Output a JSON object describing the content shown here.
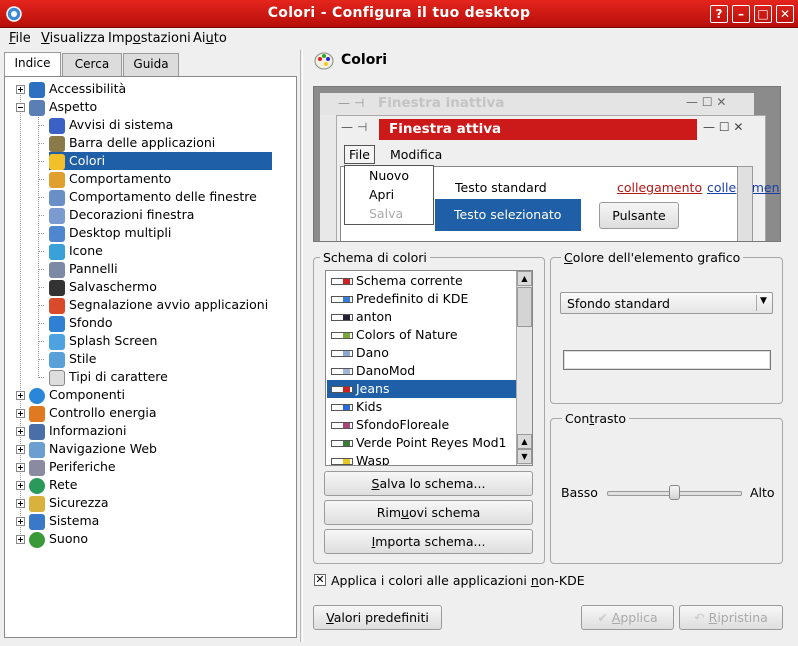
{
  "window": {
    "title": "Colori - Configura il tuo desktop",
    "btn_help": "?",
    "btn_min": "–",
    "btn_max": "□",
    "btn_close": "✕"
  },
  "menu": [
    {
      "pre": "",
      "u": "F",
      "post": "ile"
    },
    {
      "pre": "",
      "u": "V",
      "post": "isualizza"
    },
    {
      "pre": "Imp",
      "u": "o",
      "post": "stazioni"
    },
    {
      "pre": "Ai",
      "u": "u",
      "post": "to"
    }
  ],
  "tabs": {
    "indice": "Indice",
    "cerca": "Cerca",
    "guida": "Guida"
  },
  "tree": {
    "accessibilita": "Accessibilità",
    "aspetto": "Aspetto",
    "avvisi": "Avvisi di sistema",
    "barra": "Barra delle applicazioni",
    "colori": "Colori",
    "comportamento": "Comportamento",
    "comp_finestre": "Comportamento delle finestre",
    "decorazioni": "Decorazioni finestra",
    "desktop": "Desktop multipli",
    "icone": "Icone",
    "pannelli": "Pannelli",
    "salvaschermo": "Salvaschermo",
    "segnalazione": "Segnalazione avvio applicazioni",
    "sfondo": "Sfondo",
    "splash": "Splash Screen",
    "stile": "Stile",
    "tipi": "Tipi di carattere",
    "componenti": "Componenti",
    "energia": "Controllo energia",
    "informazioni": "Informazioni",
    "navigazione": "Navigazione Web",
    "periferiche": "Periferiche",
    "rete": "Rete",
    "sicurezza": "Sicurezza",
    "sistema": "Sistema",
    "suono": "Suono"
  },
  "panel_title": "Colori",
  "preview": {
    "inactive_title": "Finestra inattiva",
    "active_title": "Finestra attiva",
    "menu_file": "File",
    "menu_modifica": "Modifica",
    "popup_nuovo": "Nuovo",
    "popup_apri": "Apri",
    "popup_salva": "Salva",
    "testo_standard": "Testo standard",
    "testo_selezionato": "Testo selezionato",
    "collegamento": "collegamento",
    "collegamento2": "collegamento",
    "pulsante": "Pulsante"
  },
  "schema": {
    "title": "Schema di colori",
    "items": [
      "Schema corrente",
      "Predefinito di KDE",
      "anton",
      "Colors of Nature",
      "Dano",
      "DanoMod",
      "Jeans",
      "Kids",
      "SfondoFloreale",
      "Verde Point Reyes Mod1",
      "Wasp"
    ],
    "selected_index": 6,
    "salva": {
      "pre": "",
      "u": "S",
      "post": "alva lo schema..."
    },
    "rimuovi": {
      "pre": "Rim",
      "u": "u",
      "post": "ovi schema"
    },
    "importa": {
      "pre": "",
      "u": "I",
      "post": "mporta schema..."
    }
  },
  "colore": {
    "title_pre": "",
    "title_u": "C",
    "title_post": "olore dell'elemento grafico",
    "selected": "Sfondo standard"
  },
  "contrasto": {
    "title_pre": "Con",
    "title_u": "t",
    "title_post": "rasto",
    "basso": "Basso",
    "alto": "Alto",
    "level": 0.5
  },
  "apply_checkbox": {
    "pre": "Applica i colori alle applicazioni ",
    "u": "n",
    "post": "on-KDE",
    "checked": true
  },
  "footer": {
    "predefiniti": {
      "pre": "",
      "u": "V",
      "post": "alori predefiniti"
    },
    "applica": {
      "pre": "",
      "u": "A",
      "post": "pplica"
    },
    "ripristina": {
      "pre": "",
      "u": "R",
      "post": "ipristina"
    }
  },
  "colors": {
    "titlebar": "#cf1a14",
    "selection": "#1f5fa8",
    "active_title": "#cc1a1a"
  }
}
